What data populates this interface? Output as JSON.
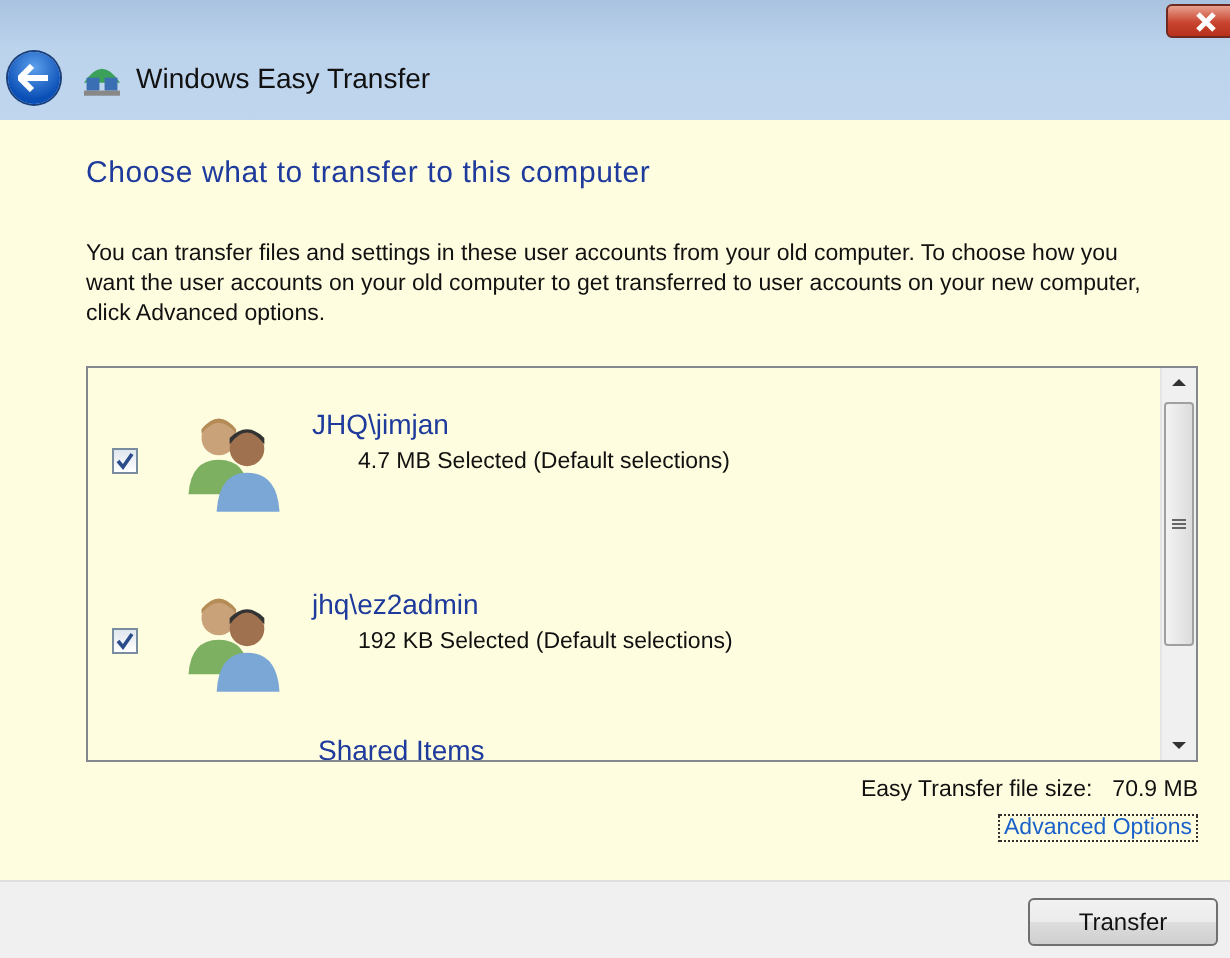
{
  "window": {
    "title": "Windows Easy Transfer"
  },
  "heading": "Choose what to transfer to this computer",
  "description": "You can transfer files and settings in these user accounts from your old computer. To choose how you want the user accounts on your old computer to get transferred to user accounts on your new computer, click Advanced options.",
  "accounts": [
    {
      "name": "JHQ\\jimjan",
      "detail": "4.7 MB Selected (Default selections)",
      "checked": true
    },
    {
      "name": "jhq\\ez2admin",
      "detail": "192 KB Selected (Default selections)",
      "checked": true
    }
  ],
  "partial_item": "Shared Items",
  "file_size": {
    "label": "Easy Transfer file size:",
    "value": "70.9 MB"
  },
  "advanced_link": "Advanced Options",
  "buttons": [
    "Transfer"
  ]
}
